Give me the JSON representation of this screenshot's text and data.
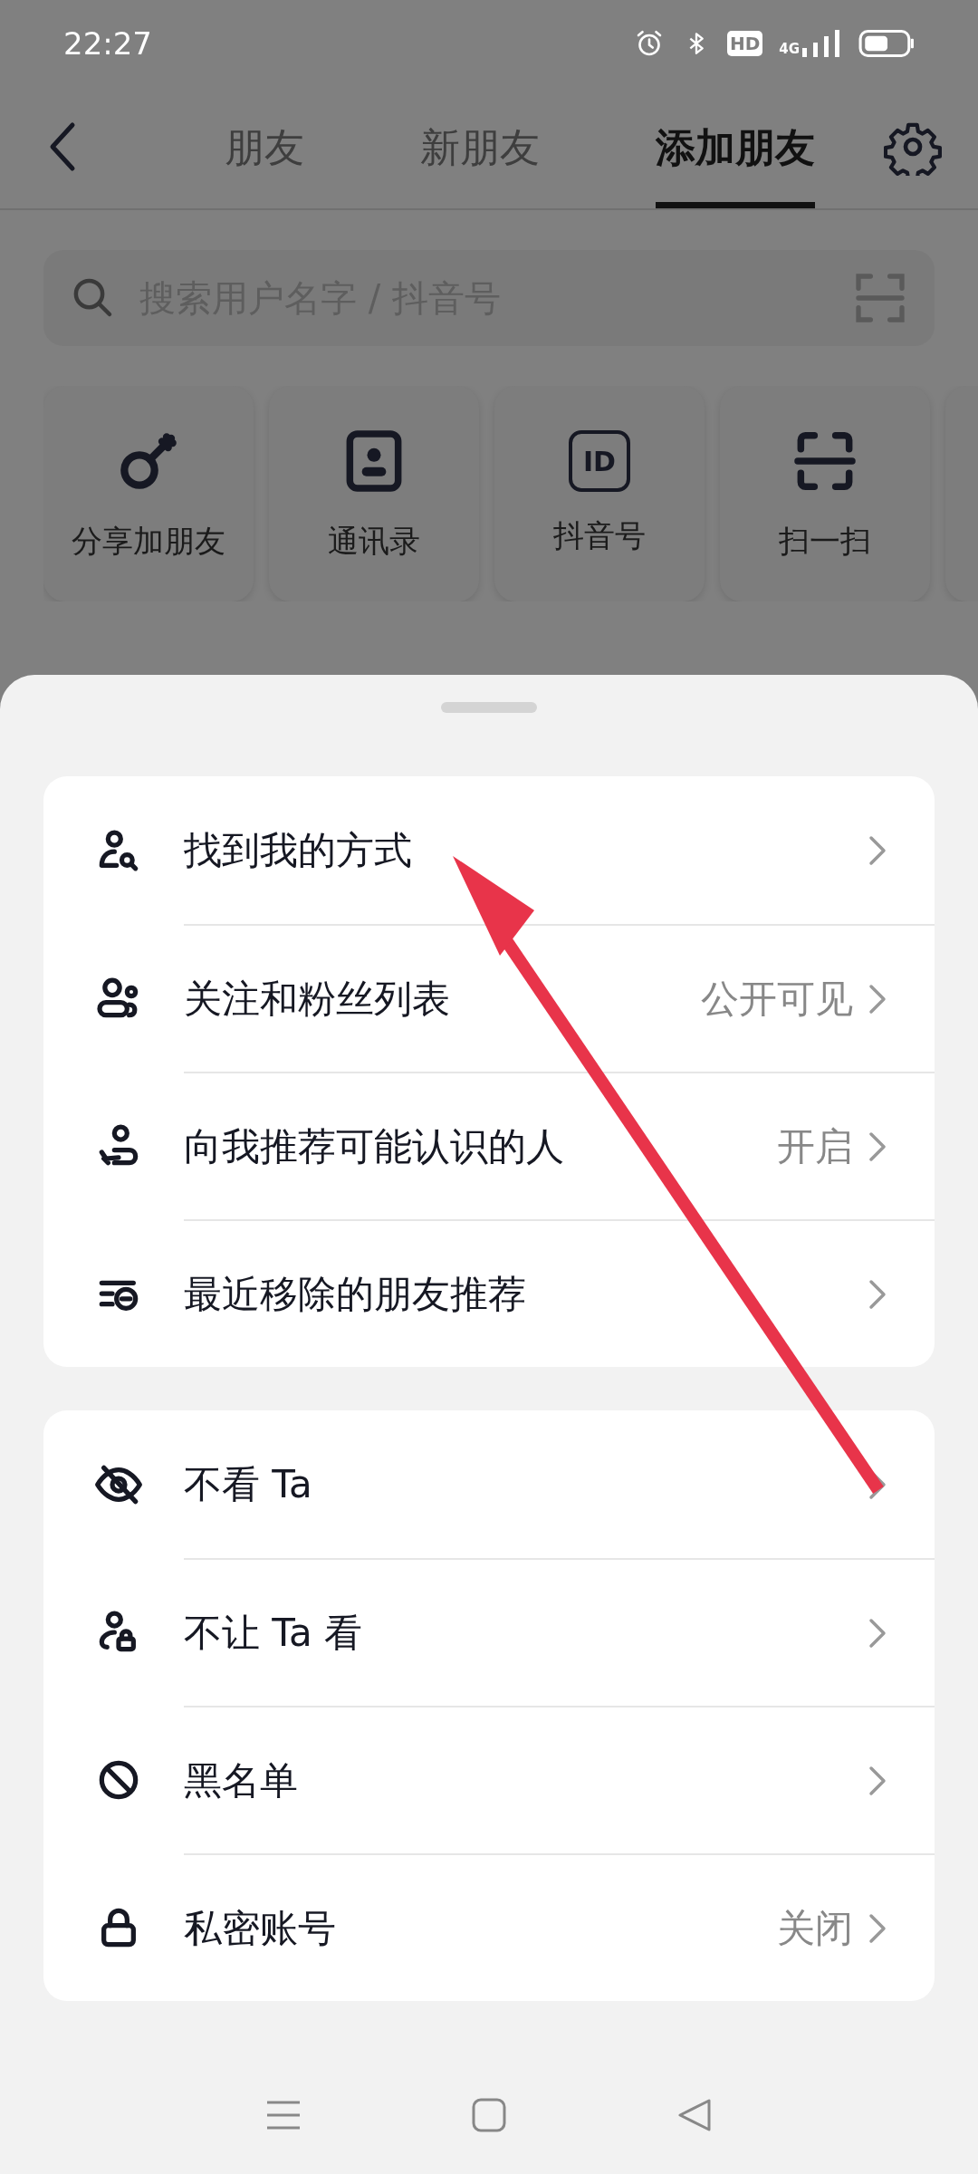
{
  "status_bar": {
    "time": "22:27",
    "hd_badge": "HD",
    "network": "4G"
  },
  "tabs": [
    {
      "label": "朋友",
      "selected": false
    },
    {
      "label": "新朋友",
      "selected": false
    },
    {
      "label": "添加朋友",
      "selected": true
    }
  ],
  "search": {
    "placeholder": "搜索用户名字 / 抖音号"
  },
  "quick_actions": [
    {
      "label": "分享加朋友"
    },
    {
      "label": "通讯录"
    },
    {
      "label": "抖音号",
      "icon_text": "ID"
    },
    {
      "label": "扫一扫"
    }
  ],
  "sheet": {
    "sections": [
      {
        "items": [
          {
            "label": "找到我的方式"
          },
          {
            "label": "关注和粉丝列表",
            "value": "公开可见"
          },
          {
            "label": "向我推荐可能认识的人",
            "value": "开启"
          },
          {
            "label": "最近移除的朋友推荐"
          }
        ]
      },
      {
        "items": [
          {
            "label": "不看 Ta"
          },
          {
            "label": "不让 Ta 看"
          },
          {
            "label": "黑名单"
          },
          {
            "label": "私密账号",
            "value": "关闭"
          }
        ]
      }
    ]
  }
}
